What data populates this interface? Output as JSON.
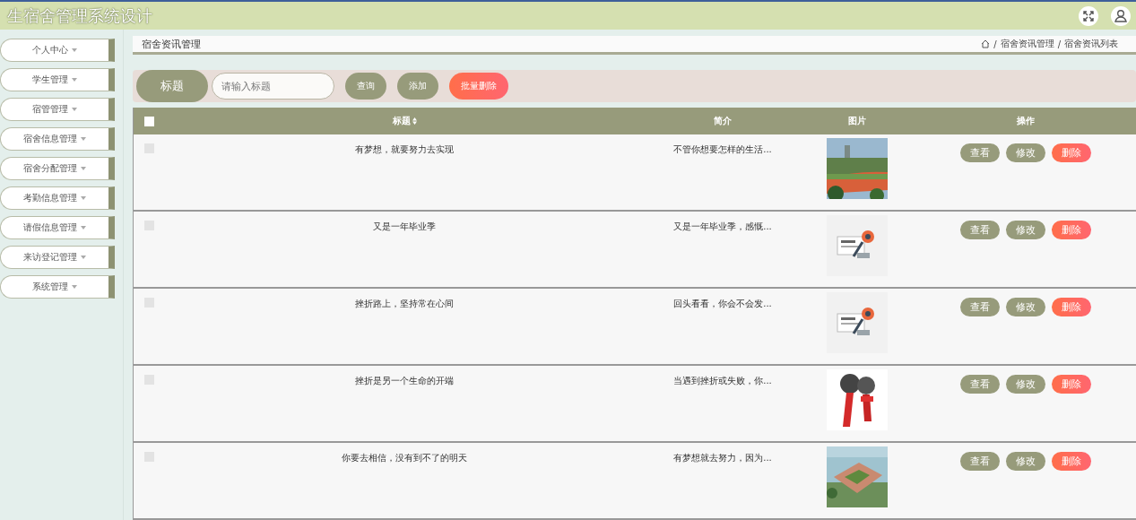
{
  "window": {
    "title": "生宿舍管理系统设计"
  },
  "sidebar": {
    "items": [
      {
        "label": "个人中心"
      },
      {
        "label": "学生管理"
      },
      {
        "label": "宿管管理"
      },
      {
        "label": "宿舍信息管理"
      },
      {
        "label": "宿舍分配管理"
      },
      {
        "label": "考勤信息管理"
      },
      {
        "label": "请假信息管理"
      },
      {
        "label": "来访登记管理"
      },
      {
        "label": "系统管理"
      }
    ]
  },
  "header": {
    "title": "宿舍资讯管理",
    "breadcrumb": [
      {
        "separator": "/",
        "label": "宿舍资讯管理"
      },
      {
        "separator": "/",
        "label": "宿舍资讯列表"
      }
    ]
  },
  "search": {
    "label": "标题",
    "placeholder": "请输入标题"
  },
  "buttons": [
    {
      "label": "查询",
      "kind": "normal"
    },
    {
      "label": "添加",
      "kind": "normal"
    },
    {
      "label": "批量删除",
      "kind": "danger"
    }
  ],
  "table": {
    "all_checked": false,
    "columns": [
      "标题",
      "简介",
      "图片",
      "操作"
    ],
    "rows": [
      {
        "checked": false,
        "title": "有梦想，就要努力去实现",
        "intro": "不管你想要怎样的生活...",
        "image": {
          "kind": "picture"
        },
        "actions": [
          {
            "label": "查看",
            "kind": "normal"
          },
          {
            "label": "修改",
            "kind": "normal"
          },
          {
            "label": "删除",
            "kind": "danger"
          }
        ]
      },
      {
        "checked": false,
        "title": "又是一年毕业季",
        "intro": "又是一年毕业季，感慨...",
        "image": {
          "kind": "picture"
        },
        "actions": [
          {
            "label": "查看",
            "kind": "normal"
          },
          {
            "label": "修改",
            "kind": "normal"
          },
          {
            "label": "删除",
            "kind": "danger"
          }
        ]
      },
      {
        "checked": false,
        "title": "挫折路上，坚持常在心间",
        "intro": "回头看看，你会不会发...",
        "image": {
          "kind": "picture"
        },
        "actions": [
          {
            "label": "查看",
            "kind": "normal"
          },
          {
            "label": "修改",
            "kind": "normal"
          },
          {
            "label": "删除",
            "kind": "danger"
          }
        ]
      },
      {
        "checked": false,
        "title": "挫折是另一个生命的开端",
        "intro": "当遇到挫折或失败，你...",
        "image": {
          "kind": "picture"
        },
        "actions": [
          {
            "label": "查看",
            "kind": "normal"
          },
          {
            "label": "修改",
            "kind": "normal"
          },
          {
            "label": "删除",
            "kind": "danger"
          }
        ]
      },
      {
        "checked": false,
        "title": "你要去相信，没有到不了的明天",
        "intro": "有梦想就去努力，因为...",
        "image": {
          "kind": "picture"
        },
        "actions": [
          {
            "label": "查看",
            "kind": "normal"
          },
          {
            "label": "修改",
            "kind": "normal"
          },
          {
            "label": "删除",
            "kind": "danger"
          }
        ]
      }
    ]
  }
}
